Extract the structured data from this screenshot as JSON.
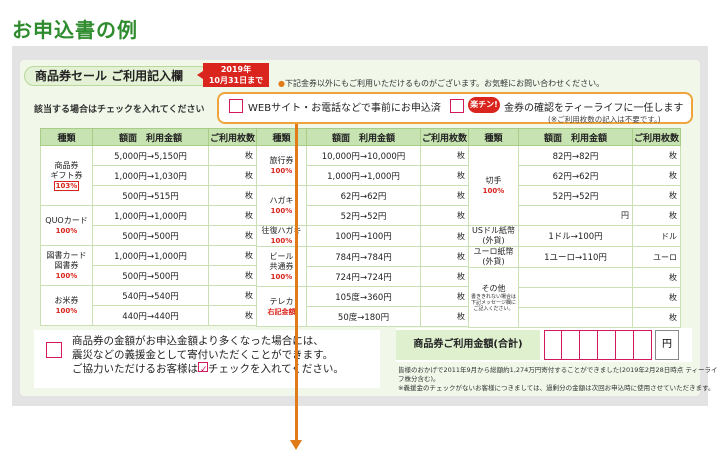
{
  "heading": "お申込書の例",
  "form_title": "商品券セール ご利用記入欄",
  "deadline": {
    "year": "2019年",
    "date": "10月31日まで"
  },
  "note_top": "下記金券以外にもご利用いただけるものがございます。お気軽にお問い合わせください。",
  "check_label": "該当する場合はチェックを入れてください",
  "options": {
    "web": "WEBサイト・お電話などで事前にお申込済",
    "badge": "楽チン!",
    "teelife": "金券の確認をティーライフに一任します",
    "sub_note": "(※ご利用枚数の記入は不要です。)"
  },
  "table_headers": {
    "type": "種類",
    "face": "額面",
    "usage": "利用金額",
    "count": "ご利用枚数"
  },
  "unit_sheet": "枚",
  "left_table": {
    "gift_name": "商品券\nギフト券",
    "gift_rate": "103%",
    "quo_name": "QUOカード",
    "quo_rate": "100%",
    "tosho_name": "図書カード\n図書券",
    "tosho_rate": "100%",
    "rice_name": "お米券",
    "rice_rate": "100%",
    "rows": [
      {
        "face": "5,000円",
        "usage": "5,150円"
      },
      {
        "face": "1,000円",
        "usage": "1,030円"
      },
      {
        "face": "500円",
        "usage": "515円"
      },
      {
        "face": "1,000円",
        "usage": "1,000円"
      },
      {
        "face": "500円",
        "usage": "500円"
      },
      {
        "face": "1,000円",
        "usage": "1,000円"
      },
      {
        "face": "500円",
        "usage": "500円"
      },
      {
        "face": "540円",
        "usage": "540円"
      },
      {
        "face": "440円",
        "usage": "440円"
      }
    ]
  },
  "mid_table": {
    "travel_name": "旅行券",
    "travel_rate": "100%",
    "hagaki_name": "ハガキ",
    "hagaki_rate": "100%",
    "ofuku_name": "往復ハガキ",
    "ofuku_rate": "100%",
    "beer_name": "ビール\n共通券",
    "beer_rate": "100%",
    "tele_name": "テレカ",
    "tele_rate": "右記金額",
    "rows": [
      {
        "face": "10,000円",
        "usage": "10,000円"
      },
      {
        "face": "1,000円",
        "usage": "1,000円"
      },
      {
        "face": "62円",
        "usage": "62円"
      },
      {
        "face": "52円",
        "usage": "52円"
      },
      {
        "face": "100円",
        "usage": "100円"
      },
      {
        "face": "784円",
        "usage": "784円"
      },
      {
        "face": "724円",
        "usage": "724円"
      },
      {
        "face": "105度",
        "usage": "360円"
      },
      {
        "face": "50度",
        "usage": "180円"
      }
    ]
  },
  "right_table": {
    "stamp_name": "切手",
    "stamp_rate": "100%",
    "usd_name": "USドル紙幣\n(外貨)",
    "eur_name": "ユーロ紙幣\n(外貨)",
    "other_name": "その他",
    "other_note": "書ききれない場合は下記メッセージ欄にご記入ください。",
    "unit_dollar": "ドル",
    "unit_euro": "ユーロ",
    "rows": [
      {
        "face": "82円",
        "usage": "82円"
      },
      {
        "face": "62円",
        "usage": "62円"
      },
      {
        "face": "52円",
        "usage": "52円"
      },
      {
        "face": "",
        "usage": "円"
      },
      {
        "face": "1ドル",
        "usage": "100円"
      },
      {
        "face": "1ユーロ",
        "usage": "110円"
      }
    ]
  },
  "arrow": "→",
  "donation": {
    "line1": "商品券の金額がお申込金額より多くなった場合には、",
    "line2": "震災などの義援金として寄付いただくことができます。",
    "line3a": "ご協力いただけるお客様は",
    "line3b": "チェックを入れてください。"
  },
  "total_label": "商品券ご利用金額(合計)",
  "yen": "円",
  "bottom_note": {
    "line1": "皆様のおかげで2011年9月から総額約1,274万円寄付することができました(2019年2月28日時点 ティーライフ株分含む)。",
    "line2": "※義援金のチェックがないお客様につきましては、過剰分の金額は次回お申込時に使用させていただきます。"
  }
}
